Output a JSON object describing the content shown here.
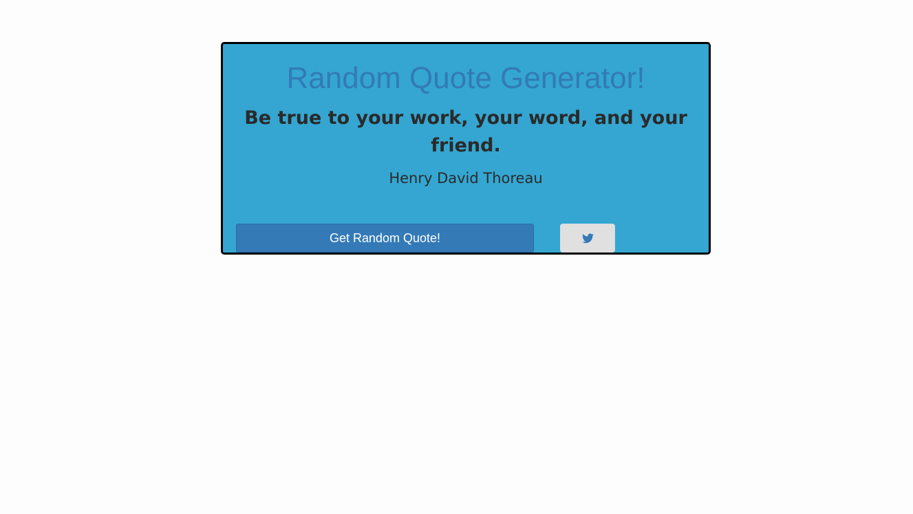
{
  "app": {
    "title": "Random Quote Generator!"
  },
  "quote": {
    "text": "Be true to your work, your word, and your friend.",
    "author": "Henry David Thoreau"
  },
  "buttons": {
    "get_quote_label": "Get Random Quote!",
    "tweet_icon": "twitter-icon"
  },
  "colors": {
    "card_background": "#34a6d1",
    "title": "#337ab7",
    "primary_button": "#337ab7",
    "tweet_button": "#e0e0e0"
  }
}
